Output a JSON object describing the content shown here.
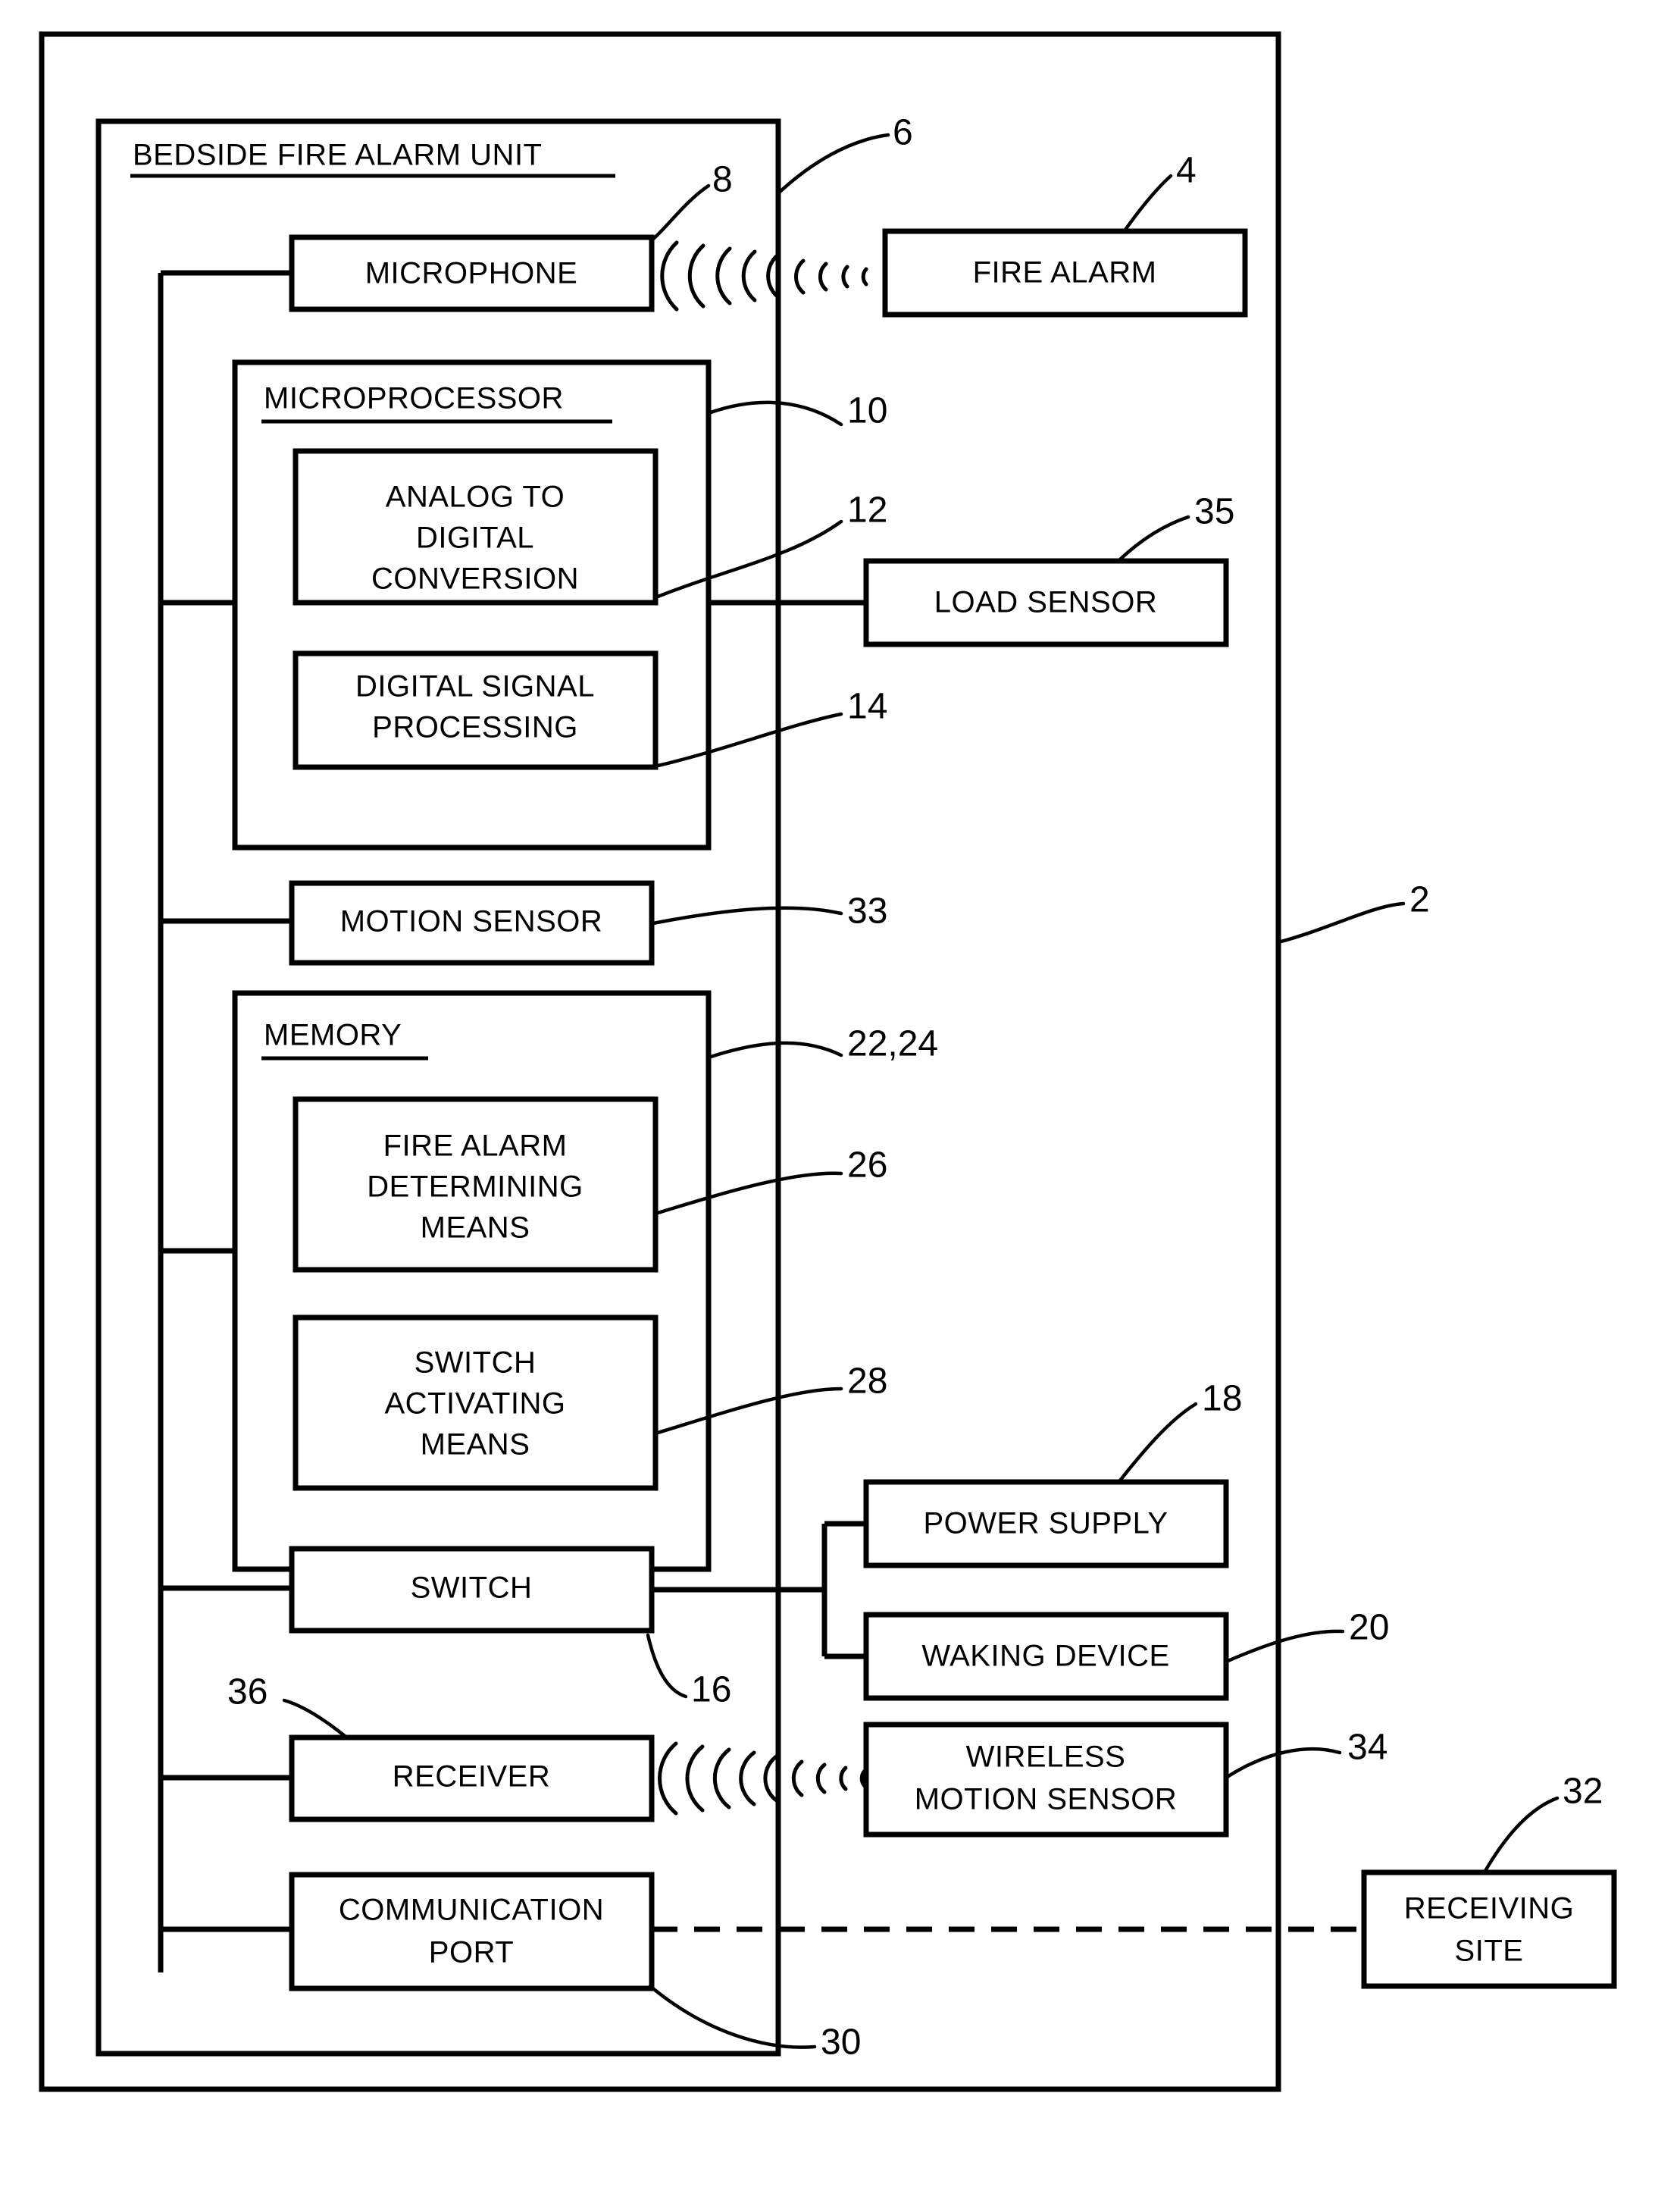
{
  "figure": {
    "title": "BEDSIDE FIRE ALARM UNIT",
    "outer_ref": "2",
    "unit_ref": "6"
  },
  "boxes": {
    "microphone": {
      "label": "MICROPHONE",
      "ref": "8"
    },
    "fire_alarm": {
      "label": "FIRE ALARM",
      "ref": "4"
    },
    "microprocessor": {
      "label": "MICROPROCESSOR",
      "ref": "10"
    },
    "adc": {
      "line1": "ANALOG TO",
      "line2": "DIGITAL",
      "line3": "CONVERSION",
      "ref": "12"
    },
    "dsp": {
      "line1": "DIGITAL SIGNAL",
      "line2": "PROCESSING",
      "ref": "14"
    },
    "load_sensor": {
      "label": "LOAD SENSOR",
      "ref": "35"
    },
    "motion_sensor": {
      "label": "MOTION SENSOR",
      "ref": "33"
    },
    "memory": {
      "label": "MEMORY",
      "ref": "22,24"
    },
    "fire_alarm_determining": {
      "line1": "FIRE ALARM",
      "line2": "DETERMINING",
      "line3": "MEANS",
      "ref": "26"
    },
    "switch_activating": {
      "line1": "SWITCH",
      "line2": "ACTIVATING",
      "line3": "MEANS",
      "ref": "28"
    },
    "switch": {
      "label": "SWITCH",
      "ref": "16"
    },
    "power_supply": {
      "label": "POWER SUPPLY",
      "ref": "18"
    },
    "waking_device": {
      "label": "WAKING DEVICE",
      "ref": "20"
    },
    "receiver": {
      "label": "RECEIVER",
      "ref": "36"
    },
    "wireless_motion_sensor": {
      "line1": "WIRELESS",
      "line2": "MOTION SENSOR",
      "ref": "34"
    },
    "communication_port": {
      "line1": "COMMUNICATION",
      "line2": "PORT",
      "ref": "30"
    },
    "receiving_site": {
      "line1": "RECEIVING",
      "line2": "SITE",
      "ref": "32"
    }
  },
  "colors": {
    "ink": "#000000",
    "paper": "#ffffff"
  }
}
